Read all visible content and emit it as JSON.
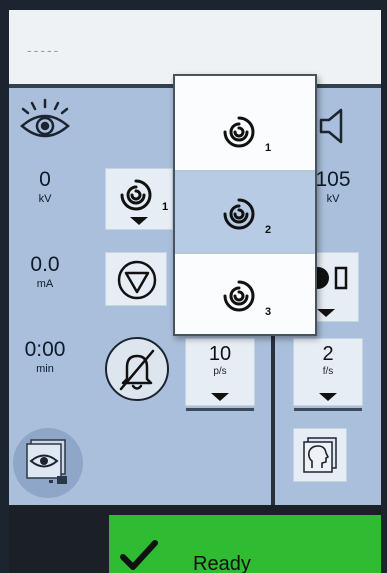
{
  "topbar": {
    "field_text": "-----"
  },
  "left": {
    "kv": {
      "value": "0",
      "unit": "kV"
    },
    "ma": {
      "value": "0.0",
      "unit": "mA"
    },
    "time": {
      "value": "0:00",
      "unit": "min"
    },
    "spiral_selector_sub": "1"
  },
  "right": {
    "kv": {
      "value": "105",
      "unit": "kV"
    },
    "frame_rate": {
      "value": "2",
      "unit": "f/s"
    }
  },
  "center": {
    "pulse_rate": {
      "value": "10",
      "unit": "p/s"
    }
  },
  "dropdown": {
    "options": [
      {
        "sub": "1",
        "selected": false
      },
      {
        "sub": "2",
        "selected": true
      },
      {
        "sub": "3",
        "selected": false
      }
    ]
  },
  "status": {
    "label": "Ready",
    "color": "#2fbc32"
  }
}
